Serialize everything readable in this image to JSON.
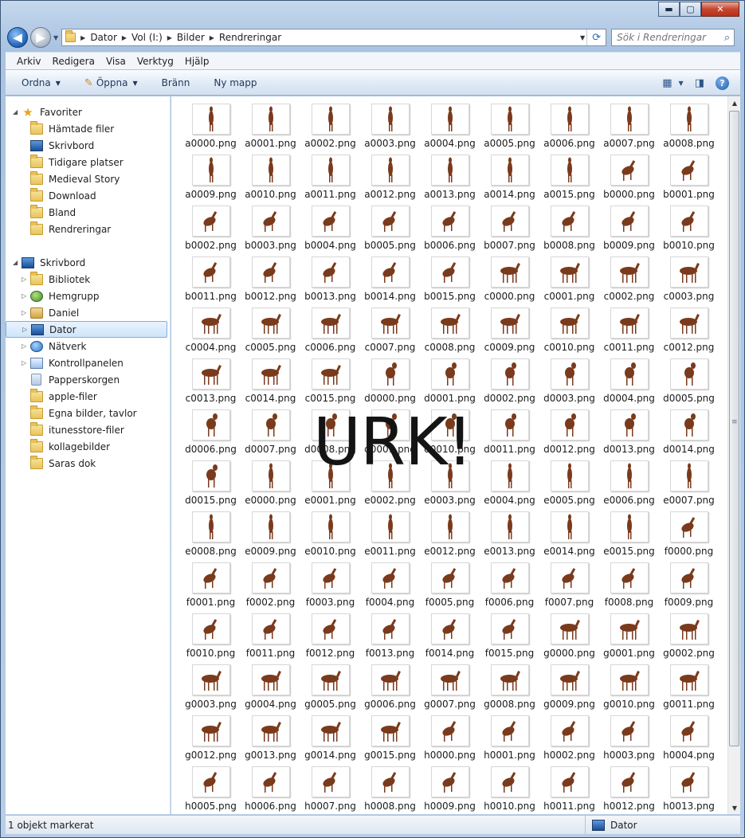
{
  "window": {
    "buttons": {
      "minimize": "▬",
      "maximize": "▢",
      "close": "✕"
    }
  },
  "address": {
    "crumbs": [
      "Dator",
      "Vol (I:)",
      "Bilder",
      "Rendreringar"
    ],
    "search_placeholder": "Sök i Rendreringar"
  },
  "menu": [
    "Arkiv",
    "Redigera",
    "Visa",
    "Verktyg",
    "Hjälp"
  ],
  "commands": {
    "organize": "Ordna",
    "open": "Öppna",
    "burn": "Bränn",
    "new_folder": "Ny mapp"
  },
  "nav": {
    "favorites": {
      "label": "Favoriter",
      "items": [
        "Hämtade filer",
        "Skrivbord",
        "Tidigare platser",
        "Medieval Story",
        "Download",
        "Bland",
        "Rendreringar"
      ]
    },
    "desktop": {
      "label": "Skrivbord",
      "items": [
        "Bibliotek",
        "Hemgrupp",
        "Daniel",
        "Dator",
        "Nätverk",
        "Kontrollpanelen",
        "Papperskorgen",
        "apple-filer",
        "Egna bilder, tavlor",
        "itunesstore-filer",
        "kollagebilder",
        "Saras dok"
      ],
      "selected": "Dator"
    }
  },
  "files": [
    "a0000.png",
    "a0001.png",
    "a0002.png",
    "a0003.png",
    "a0004.png",
    "a0005.png",
    "a0006.png",
    "a0007.png",
    "a0008.png",
    "a0009.png",
    "a0010.png",
    "a0011.png",
    "a0012.png",
    "a0013.png",
    "a0014.png",
    "a0015.png",
    "b0000.png",
    "b0001.png",
    "b0002.png",
    "b0003.png",
    "b0004.png",
    "b0005.png",
    "b0006.png",
    "b0007.png",
    "b0008.png",
    "b0009.png",
    "b0010.png",
    "b0011.png",
    "b0012.png",
    "b0013.png",
    "b0014.png",
    "b0015.png",
    "c0000.png",
    "c0001.png",
    "c0002.png",
    "c0003.png",
    "c0004.png",
    "c0005.png",
    "c0006.png",
    "c0007.png",
    "c0008.png",
    "c0009.png",
    "c0010.png",
    "c0011.png",
    "c0012.png",
    "c0013.png",
    "c0014.png",
    "c0015.png",
    "d0000.png",
    "d0001.png",
    "d0002.png",
    "d0003.png",
    "d0004.png",
    "d0005.png",
    "d0006.png",
    "d0007.png",
    "d0008.png",
    "d0009.png",
    "d0010.png",
    "d0011.png",
    "d0012.png",
    "d0013.png",
    "d0014.png",
    "d0015.png",
    "e0000.png",
    "e0001.png",
    "e0002.png",
    "e0003.png",
    "e0004.png",
    "e0005.png",
    "e0006.png",
    "e0007.png",
    "e0008.png",
    "e0009.png",
    "e0010.png",
    "e0011.png",
    "e0012.png",
    "e0013.png",
    "e0014.png",
    "e0015.png",
    "f0000.png",
    "f0001.png",
    "f0002.png",
    "f0003.png",
    "f0004.png",
    "f0005.png",
    "f0006.png",
    "f0007.png",
    "f0008.png",
    "f0009.png",
    "f0010.png",
    "f0011.png",
    "f0012.png",
    "f0013.png",
    "f0014.png",
    "f0015.png",
    "g0000.png",
    "g0001.png",
    "g0002.png",
    "g0003.png",
    "g0004.png",
    "g0005.png",
    "g0006.png",
    "g0007.png",
    "g0008.png",
    "g0009.png",
    "g0010.png",
    "g0011.png",
    "g0012.png",
    "g0013.png",
    "g0014.png",
    "g0015.png",
    "h0000.png",
    "h0001.png",
    "h0002.png",
    "h0003.png",
    "h0004.png",
    "h0005.png",
    "h0006.png",
    "h0007.png",
    "h0008.png",
    "h0009.png",
    "h0010.png",
    "h0011.png",
    "h0012.png",
    "h0013.png"
  ],
  "overlay_text": "URK!",
  "status": {
    "left": "1 objekt markerat",
    "right": "Dator"
  },
  "colors": {
    "horse": "#7a3a1c",
    "selection": "#cfe4fa",
    "accent": "#2a6cc2"
  }
}
